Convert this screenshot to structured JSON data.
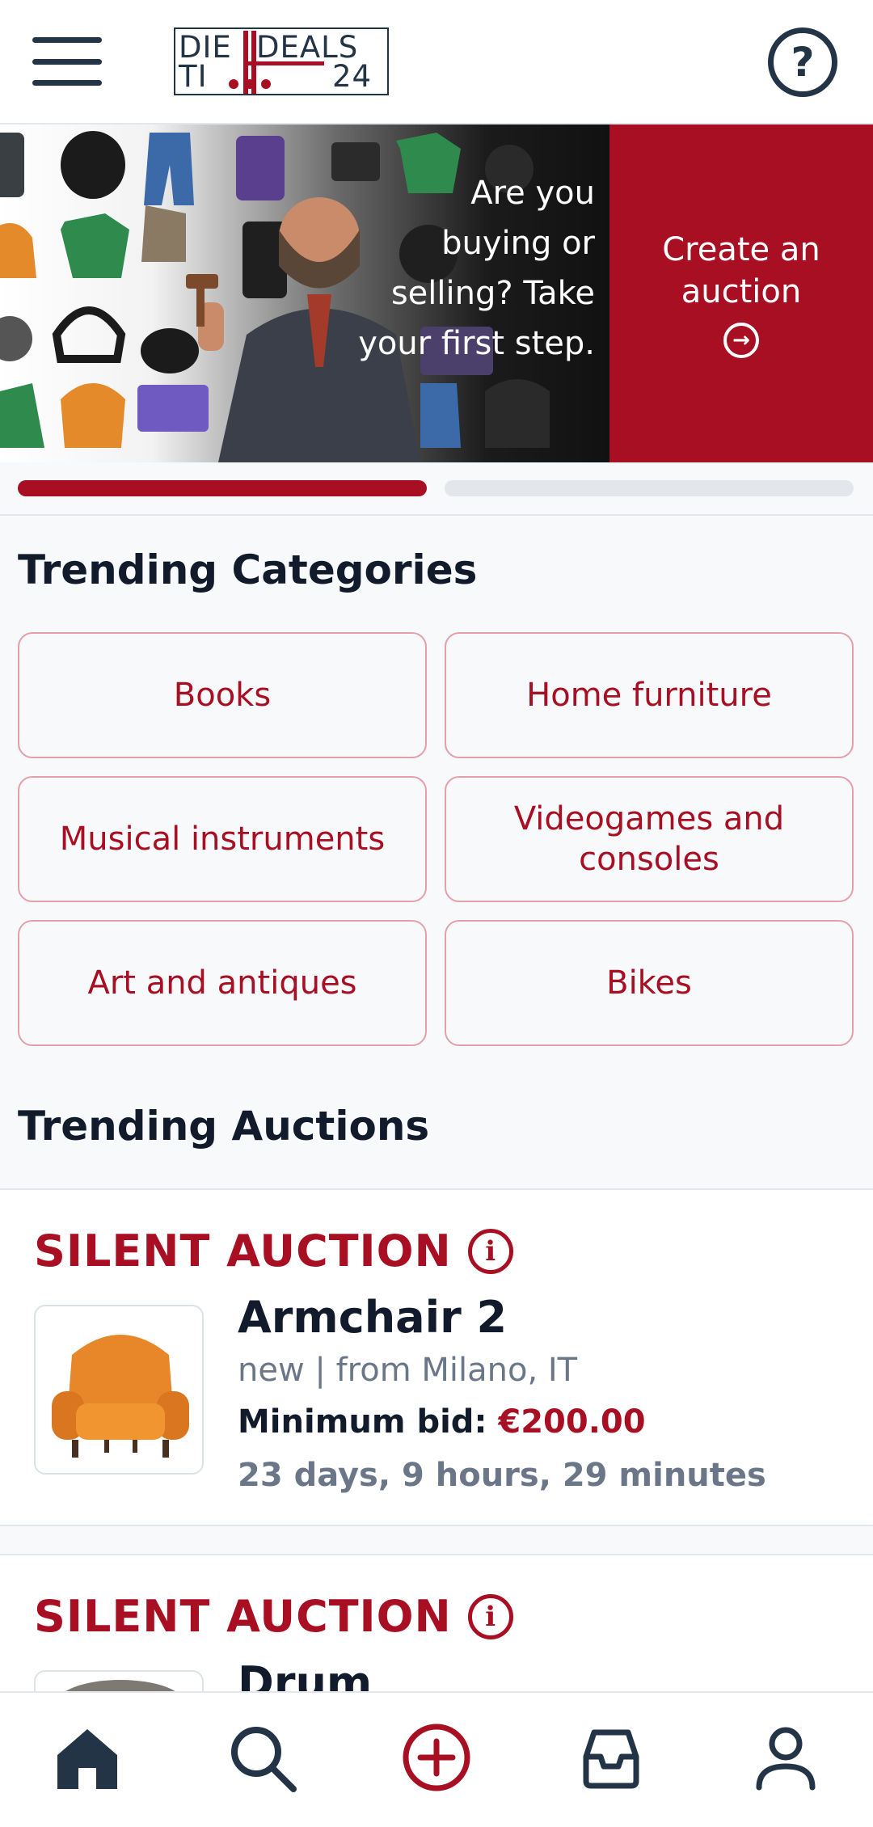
{
  "header": {
    "logo_text": "DIE DEALS TI 24",
    "logo": {
      "part1": "DIE",
      "part2": "TI",
      "part3": "DEALS",
      "part4": "24"
    }
  },
  "banner": {
    "message": "Are you buying or selling? Take your first step.",
    "cta_label": "Create an auction",
    "cta_icon": "arrow-right-circle-icon"
  },
  "carousel": {
    "slides": 2,
    "active": 1
  },
  "trending_categories": {
    "title": "Trending Categories",
    "items": [
      {
        "label": "Books"
      },
      {
        "label": "Home furniture"
      },
      {
        "label": "Musical instruments"
      },
      {
        "label": "Videogames and consoles"
      },
      {
        "label": "Art and antiques"
      },
      {
        "label": "Bikes"
      }
    ]
  },
  "trending_auctions": {
    "title": "Trending Auctions",
    "items": [
      {
        "type": "SILENT AUCTION",
        "title": "Armchair 2",
        "condition": "new",
        "location": "from Milano, IT",
        "meta": "new | from Milano, IT",
        "bid_label": "Minimum bid:",
        "bid_amount": "€200.00",
        "time_left": "23 days, 9 hours, 29 minutes"
      },
      {
        "type": "SILENT AUCTION",
        "title": "Drum"
      }
    ]
  },
  "bottom_nav": {
    "items": [
      {
        "icon": "home-icon",
        "active": true
      },
      {
        "icon": "search-icon"
      },
      {
        "icon": "add-circle-icon"
      },
      {
        "icon": "inbox-icon"
      },
      {
        "icon": "user-icon"
      }
    ]
  },
  "colors": {
    "brand_red": "#a90f23",
    "navy": "#243447",
    "muted": "#6b7789",
    "background": "#f7f9fb"
  }
}
